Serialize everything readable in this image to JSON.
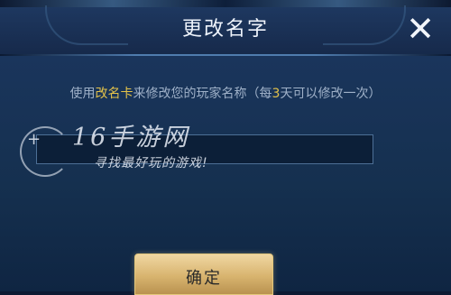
{
  "dialog": {
    "title": "更改名字",
    "close_icon": "close-icon"
  },
  "instruction": {
    "prefix": "使用",
    "item_name": "改名卡",
    "middle": "来修改您的玩家名称（每",
    "days": "3",
    "suffix": "天可以修改一次）",
    "highlight_color": "#e3c24a"
  },
  "name_input": {
    "value": "",
    "placeholder": ""
  },
  "watermark": {
    "brand": "16手游网",
    "slogan": "寻找最好玩的游戏!"
  },
  "confirm_button": {
    "label": "确定"
  }
}
